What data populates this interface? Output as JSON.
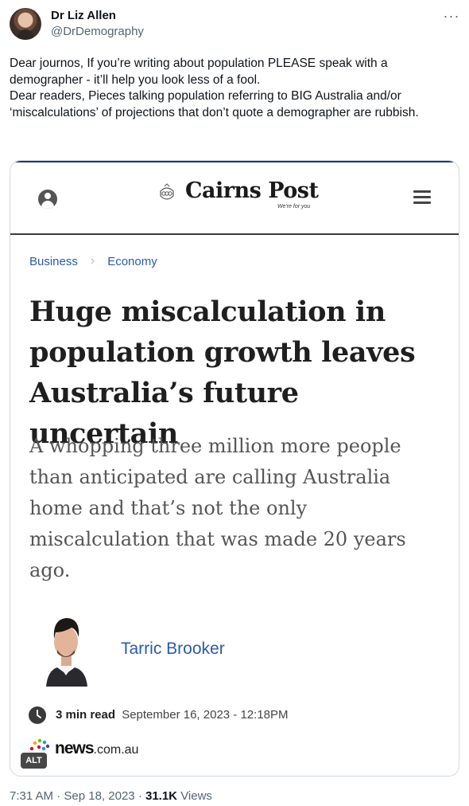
{
  "author": {
    "name": "Dr Liz Allen",
    "handle": "@DrDemography"
  },
  "more_menu": "···",
  "tweet": {
    "paragraphs": [
      "Dear journos, If you’re writing about population PLEASE speak with a demographer - it’ll help you look less of a fool.",
      "Dear readers, Pieces talking population referring to BIG Australia and/or ‘miscalculations’ of projections that don’t quote a demographer are rubbish."
    ]
  },
  "article": {
    "site_name": "Cairns Post",
    "tagline": "We're for you",
    "breadcrumb": [
      "Business",
      "Economy"
    ],
    "breadcrumb_separator": "›",
    "headline": "Huge miscalculation in population growth leaves Australia’s future uncertain",
    "standfirst": "A whopping three million more people than anticipated are calling Australia home and that’s not the only miscalculation that was made 20 years ago.",
    "byline": "Tarric Brooker",
    "read_time": "3 min read",
    "published": "September 16, 2023 - 12:18PM",
    "source_brand": "news",
    "source_domain": ".com.au",
    "alt_badge": "ALT"
  },
  "tweet_meta": {
    "time": "7:31 AM",
    "date": "Sep 18, 2023",
    "separator": "·",
    "views_count": "31.1K",
    "views_label": "Views"
  },
  "colors": {
    "link_blue": "#2b5aa8",
    "secondary_text": "#536471",
    "card_border": "#cfd9de"
  },
  "icons": [
    "user-icon",
    "menu-icon",
    "clock-icon",
    "more-icon"
  ]
}
